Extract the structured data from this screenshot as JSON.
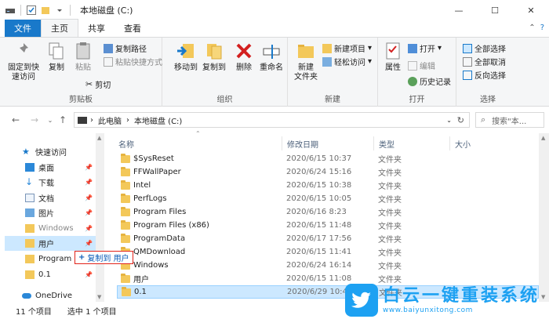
{
  "window": {
    "title": "本地磁盘 (C:)",
    "minimize": "—",
    "maximize": "☐",
    "close": "✕"
  },
  "tabs": [
    {
      "label": "文件"
    },
    {
      "label": "主页"
    },
    {
      "label": "共享"
    },
    {
      "label": "查看"
    }
  ],
  "ribbon": {
    "clipboard": {
      "pin_label": "固定到快\n速访问",
      "copy_label": "复制",
      "paste_label": "粘贴",
      "copy_path": "复制路径",
      "paste_shortcut": "粘贴快捷方式",
      "cut": "剪切",
      "group_label": "剪贴板"
    },
    "organize": {
      "move_to": "移动到",
      "copy_to": "复制到",
      "delete": "删除",
      "rename": "重命名",
      "group_label": "组织"
    },
    "new": {
      "new_folder": "新建\n文件夹",
      "new_item": "新建项目",
      "easy_access": "轻松访问",
      "group_label": "新建"
    },
    "open": {
      "properties": "属性",
      "open": "打开",
      "edit": "编辑",
      "history": "历史记录",
      "group_label": "打开"
    },
    "select": {
      "select_all": "全部选择",
      "select_none": "全部取消",
      "invert": "反向选择",
      "group_label": "选择"
    }
  },
  "address": {
    "segments": [
      "此电脑",
      "本地磁盘 (C:)"
    ],
    "search_placeholder": "搜索\"本..."
  },
  "nav": {
    "items": [
      {
        "label": "快速访问",
        "icon": "star-icon"
      },
      {
        "label": "桌面",
        "icon": "desktop-icon",
        "pinned": true
      },
      {
        "label": "下载",
        "icon": "download-icon",
        "pinned": true
      },
      {
        "label": "文档",
        "icon": "document-icon",
        "pinned": true
      },
      {
        "label": "图片",
        "icon": "picture-icon",
        "pinned": true
      },
      {
        "label": "Windows",
        "icon": "folder-icon",
        "pinned": true
      },
      {
        "label": "用户",
        "icon": "folder-icon",
        "pinned": true
      },
      {
        "label": "Program",
        "icon": "folder-icon"
      },
      {
        "label": "0.1",
        "icon": "folder-icon",
        "pinned": true
      },
      {
        "label": "OneDrive",
        "icon": "cloud-icon"
      }
    ]
  },
  "columns": {
    "name": "名称",
    "date": "修改日期",
    "type": "类型",
    "size": "大小"
  },
  "files": [
    {
      "name": "$SysReset",
      "date": "2020/6/15 10:37",
      "type": "文件夹"
    },
    {
      "name": "FFWallPaper",
      "date": "2020/6/24 15:16",
      "type": "文件夹"
    },
    {
      "name": "Intel",
      "date": "2020/6/15 10:38",
      "type": "文件夹"
    },
    {
      "name": "PerfLogs",
      "date": "2020/6/15 10:05",
      "type": "文件夹"
    },
    {
      "name": "Program Files",
      "date": "2020/6/16 8:23",
      "type": "文件夹"
    },
    {
      "name": "Program Files (x86)",
      "date": "2020/6/15 11:48",
      "type": "文件夹"
    },
    {
      "name": "ProgramData",
      "date": "2020/6/17 17:56",
      "type": "文件夹"
    },
    {
      "name": "QMDownload",
      "date": "2020/6/15 11:41",
      "type": "文件夹"
    },
    {
      "name": "Windows",
      "date": "2020/6/24 16:14",
      "type": "文件夹"
    },
    {
      "name": "用户",
      "date": "2020/6/15 11:08",
      "type": "文件夹"
    },
    {
      "name": "0.1",
      "date": "2020/6/29 10:41",
      "type": "文件夹"
    }
  ],
  "status": {
    "count": "11 个项目",
    "selected": "选中 1 个项目"
  },
  "drag_tooltip": {
    "plus": "+",
    "label": "复制到 用户"
  },
  "watermark": {
    "title": "白云一键重装系统",
    "url": "www.baiyunxitong.com"
  },
  "colors": {
    "accent": "#1979ca",
    "selection": "#cce8ff",
    "drag_border": "#e2231a",
    "folder": "#f3c85a",
    "watermark": "#1da1f2"
  }
}
